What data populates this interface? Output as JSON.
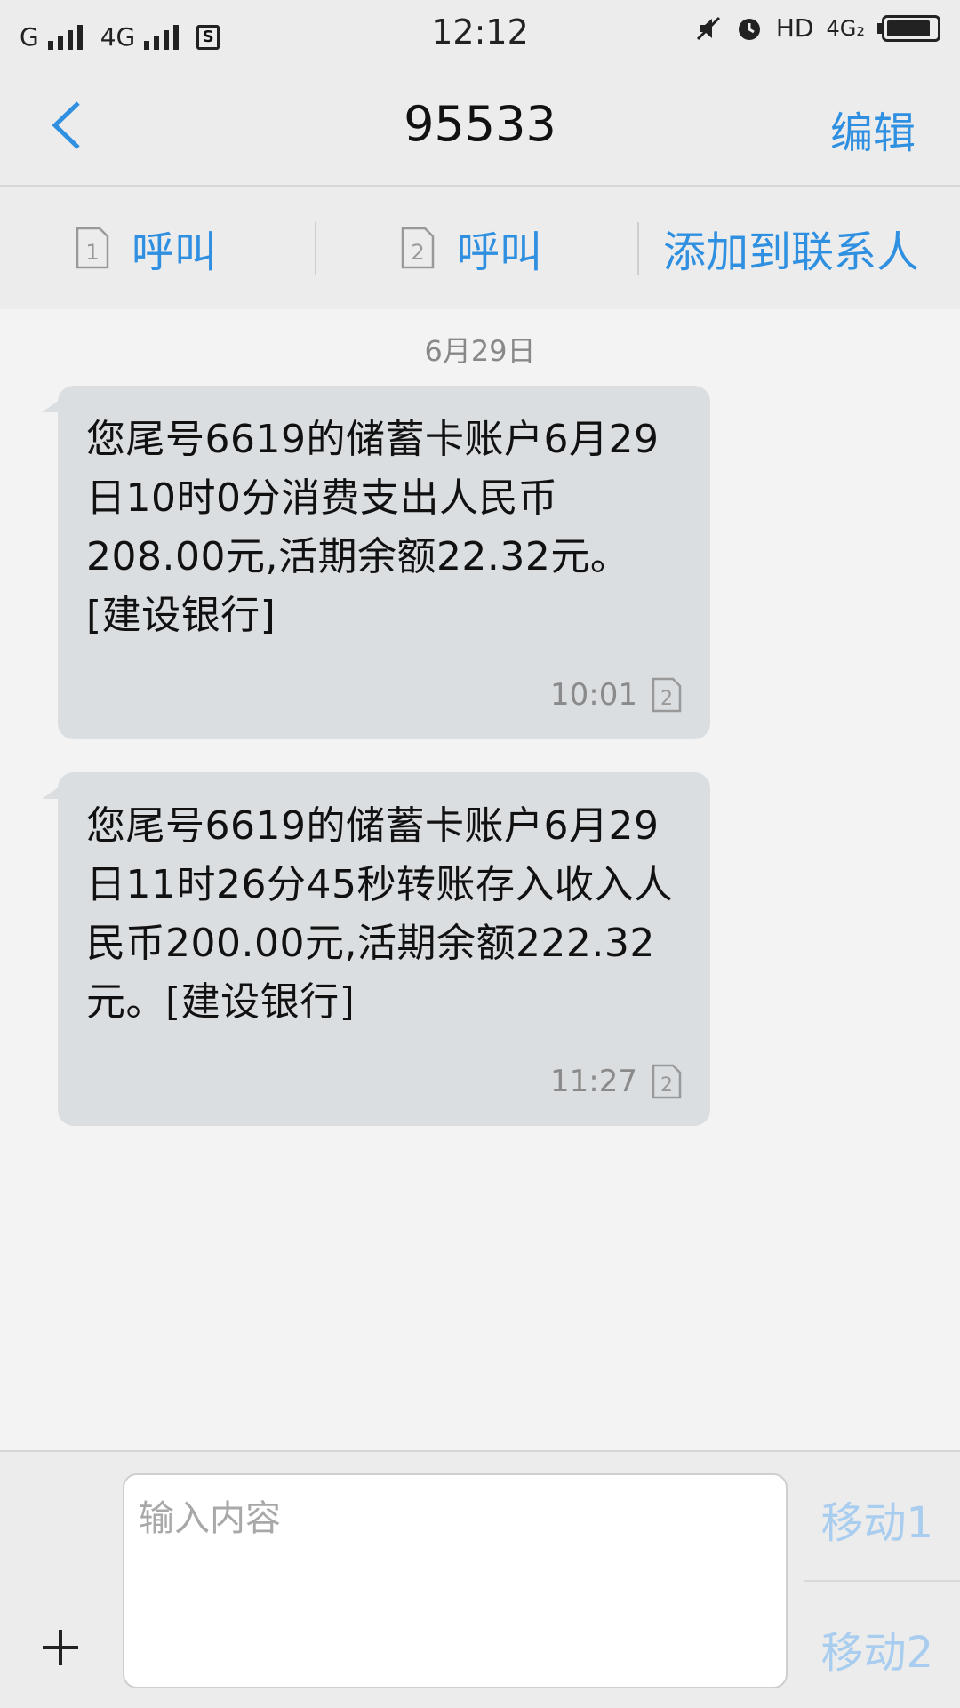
{
  "status_bar": {
    "carrier1": "G",
    "carrier2": "4G",
    "sim_icon_label": "S",
    "time": "12:12",
    "hd_label": "HD",
    "net_label": "4G₂"
  },
  "header": {
    "title": "95533",
    "edit_label": "编辑"
  },
  "actions": {
    "call1_sim": "1",
    "call1_label": "呼叫",
    "call2_sim": "2",
    "call2_label": "呼叫",
    "add_contact_label": "添加到联系人"
  },
  "conversation": {
    "date": "6月29日",
    "messages": [
      {
        "text": "您尾号6619的储蓄卡账户6月29日10时0分消费支出人民币208.00元,活期余额22.32元。[建设银行]",
        "time": "10:01",
        "sim": "2"
      },
      {
        "text": "您尾号6619的储蓄卡账户6月29日11时26分45秒转账存入收入人民币200.00元,活期余额222.32元。[建设银行]",
        "time": "11:27",
        "sim": "2"
      }
    ]
  },
  "composer": {
    "placeholder": "输入内容",
    "send1_label": "移动1",
    "send2_label": "移动2"
  },
  "colors": {
    "accent": "#2f8fe0",
    "bubble": "#dadee1",
    "disabled_send": "#a9cdef"
  }
}
